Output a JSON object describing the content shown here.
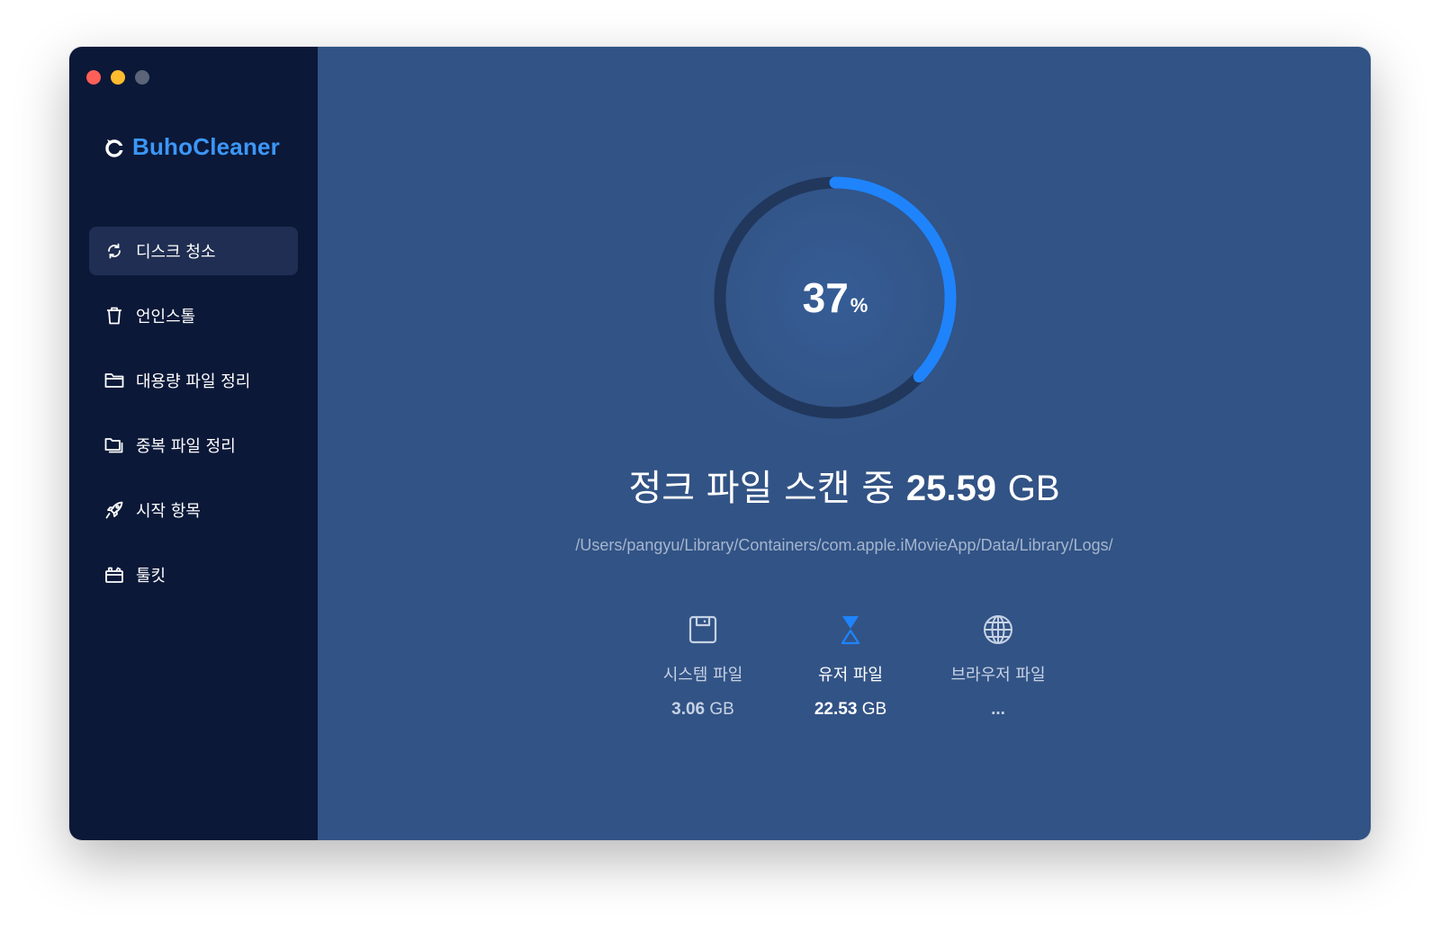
{
  "app": {
    "brand_name": "BuhoCleaner",
    "accent_color": "#1f84fb",
    "brand_color": "#3c97f7"
  },
  "window_controls": [
    "close",
    "minimize",
    "zoom"
  ],
  "sidebar": {
    "items": [
      {
        "label": "디스크 청소",
        "icon": "refresh-icon",
        "active": true
      },
      {
        "label": "언인스톨",
        "icon": "trash-icon",
        "active": false
      },
      {
        "label": "대용량 파일 정리",
        "icon": "folder-icon",
        "active": false
      },
      {
        "label": "중복 파일 정리",
        "icon": "duplicate-folder-icon",
        "active": false
      },
      {
        "label": "시작 항목",
        "icon": "rocket-icon",
        "active": false
      },
      {
        "label": "툴킷",
        "icon": "toolbox-icon",
        "active": false
      }
    ]
  },
  "scan": {
    "progress_percent": 37,
    "percent_value": "37",
    "percent_symbol": "%",
    "status_text": "정크 파일 스캔 중",
    "found_size": "25.59",
    "found_unit": "GB",
    "current_path": "/Users/pangyu/Library/Containers/com.apple.iMovieApp/Data/Library/Logs/"
  },
  "categories": [
    {
      "label": "시스템 파일",
      "size": "3.06",
      "unit": "GB",
      "icon": "disk-icon",
      "state": "done"
    },
    {
      "label": "유저 파일",
      "size": "22.53",
      "unit": "GB",
      "icon": "hourglass-icon",
      "state": "scanning"
    },
    {
      "label": "브라우저 파일",
      "size": "...",
      "unit": "",
      "icon": "globe-icon",
      "state": "pending"
    }
  ]
}
